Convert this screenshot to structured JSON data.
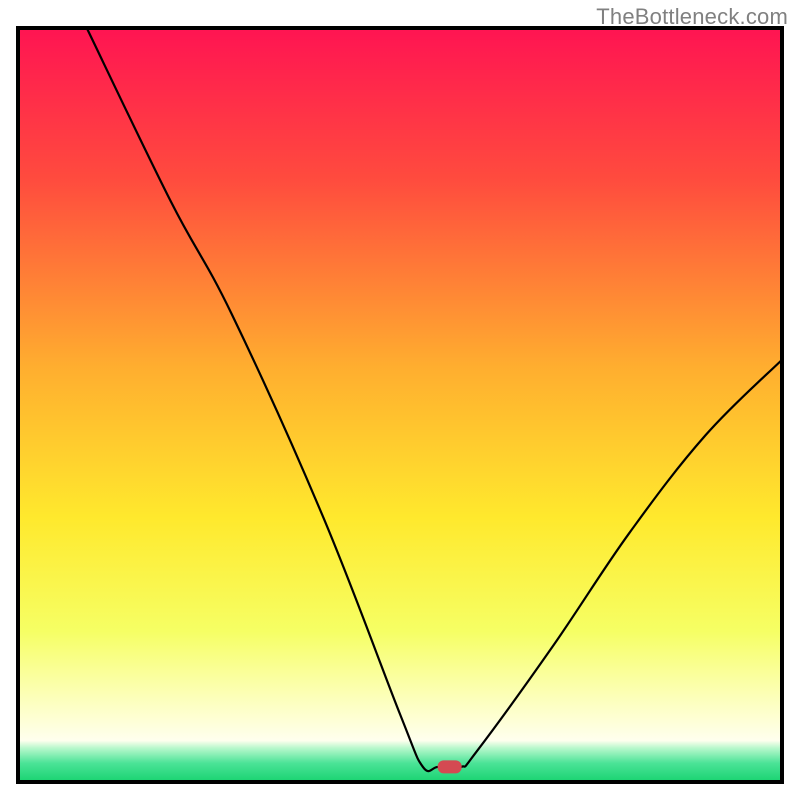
{
  "watermark": "TheBottleneck.com",
  "chart_data": {
    "type": "line",
    "title": "",
    "xlabel": "",
    "ylabel": "",
    "xlim": [
      0,
      100
    ],
    "ylim": [
      0,
      100
    ],
    "notch_x": 56,
    "series": [
      {
        "name": "curve",
        "points": [
          {
            "x": 9.0,
            "y": 100.0
          },
          {
            "x": 20.0,
            "y": 77.0
          },
          {
            "x": 28.0,
            "y": 62.0
          },
          {
            "x": 40.0,
            "y": 35.0
          },
          {
            "x": 50.0,
            "y": 9.0
          },
          {
            "x": 53.0,
            "y": 2.0
          },
          {
            "x": 55.0,
            "y": 2.0
          },
          {
            "x": 58.0,
            "y": 2.0
          },
          {
            "x": 60.0,
            "y": 4.0
          },
          {
            "x": 70.0,
            "y": 18.0
          },
          {
            "x": 80.0,
            "y": 33.0
          },
          {
            "x": 90.0,
            "y": 46.0
          },
          {
            "x": 100.0,
            "y": 56.0
          }
        ]
      }
    ],
    "gradient_stops": [
      {
        "offset": 0.0,
        "color": "#ff1452"
      },
      {
        "offset": 0.2,
        "color": "#ff4b3e"
      },
      {
        "offset": 0.45,
        "color": "#ffae2f"
      },
      {
        "offset": 0.65,
        "color": "#ffe92d"
      },
      {
        "offset": 0.8,
        "color": "#f6ff64"
      },
      {
        "offset": 0.9,
        "color": "#fdffc5"
      },
      {
        "offset": 0.945,
        "color": "#ffffee"
      },
      {
        "offset": 0.955,
        "color": "#b8f8cc"
      },
      {
        "offset": 0.975,
        "color": "#4be397"
      },
      {
        "offset": 1.0,
        "color": "#18d370"
      }
    ],
    "marker": {
      "x": 56.5,
      "y": 2.0,
      "color": "#d44a52"
    }
  }
}
